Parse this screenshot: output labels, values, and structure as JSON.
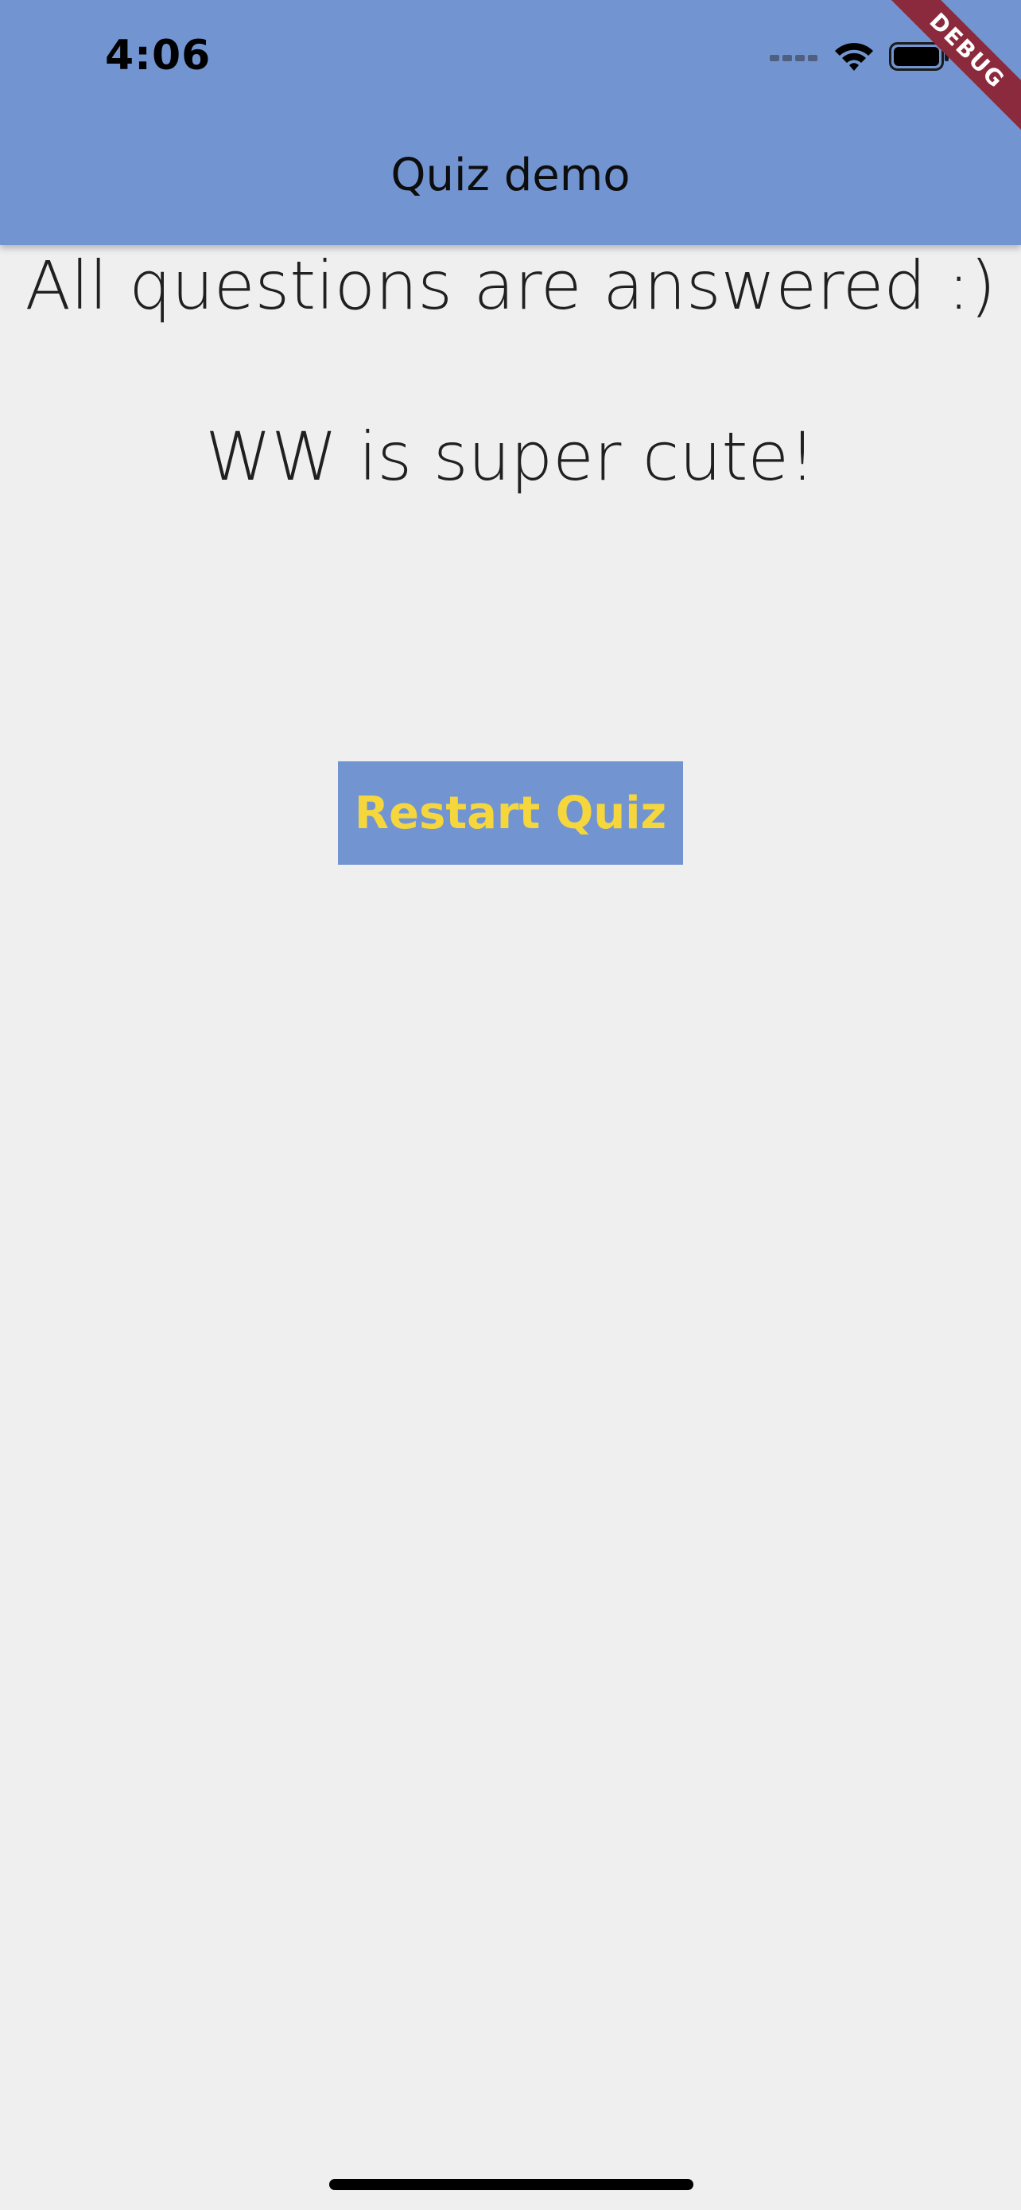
{
  "status_bar": {
    "time": "4:06",
    "icons": [
      "cellular-signal-icon",
      "wifi-icon",
      "battery-icon"
    ]
  },
  "app_bar": {
    "title": "Quiz demo",
    "background": "#7295d1"
  },
  "debug_banner": {
    "label": "DEBUG",
    "color": "#8b2a3d"
  },
  "result": {
    "line1": "All questions are answered :)",
    "line2": "WW is super cute!"
  },
  "restart_button": {
    "label": "Restart Quiz",
    "background": "#7295d1",
    "text_color": "#f5d63d"
  }
}
